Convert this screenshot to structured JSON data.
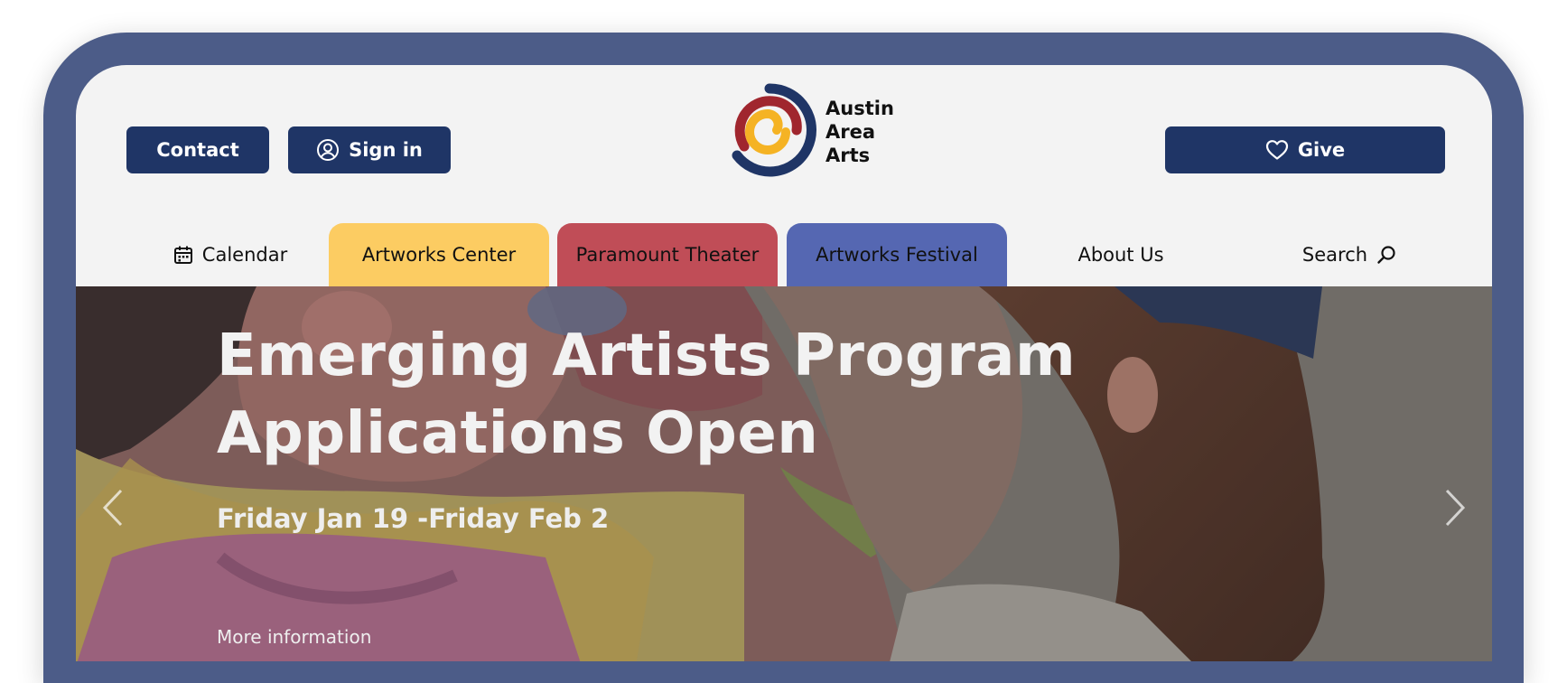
{
  "header": {
    "contact_label": "Contact",
    "signin_label": "Sign in",
    "give_label": "Give",
    "logo": {
      "line1": "Austin",
      "line2": "Area",
      "line3": "Arts",
      "icon": "spiral-logo-icon"
    }
  },
  "nav": {
    "calendar_label": "Calendar",
    "tabs": [
      {
        "label": "Artworks Center",
        "color": "#fccc62"
      },
      {
        "label": "Paramount Theater",
        "color": "#c04d57"
      },
      {
        "label": "Artworks Festival",
        "color": "#5567b2"
      }
    ],
    "about_label": "About Us",
    "search_label": "Search"
  },
  "hero": {
    "title_line1": "Emerging Artists Program",
    "title_line2": "Applications Open",
    "date": "Friday Jan 19 -Friday Feb 2",
    "more_link": "More information",
    "prev_icon": "chevron-left-icon",
    "next_icon": "chevron-right-icon"
  },
  "colors": {
    "frame": "#4c5c88",
    "primary_button": "#1f3566",
    "logo_navy": "#1f3566",
    "logo_red": "#a0262e",
    "logo_yellow": "#f5b324"
  }
}
